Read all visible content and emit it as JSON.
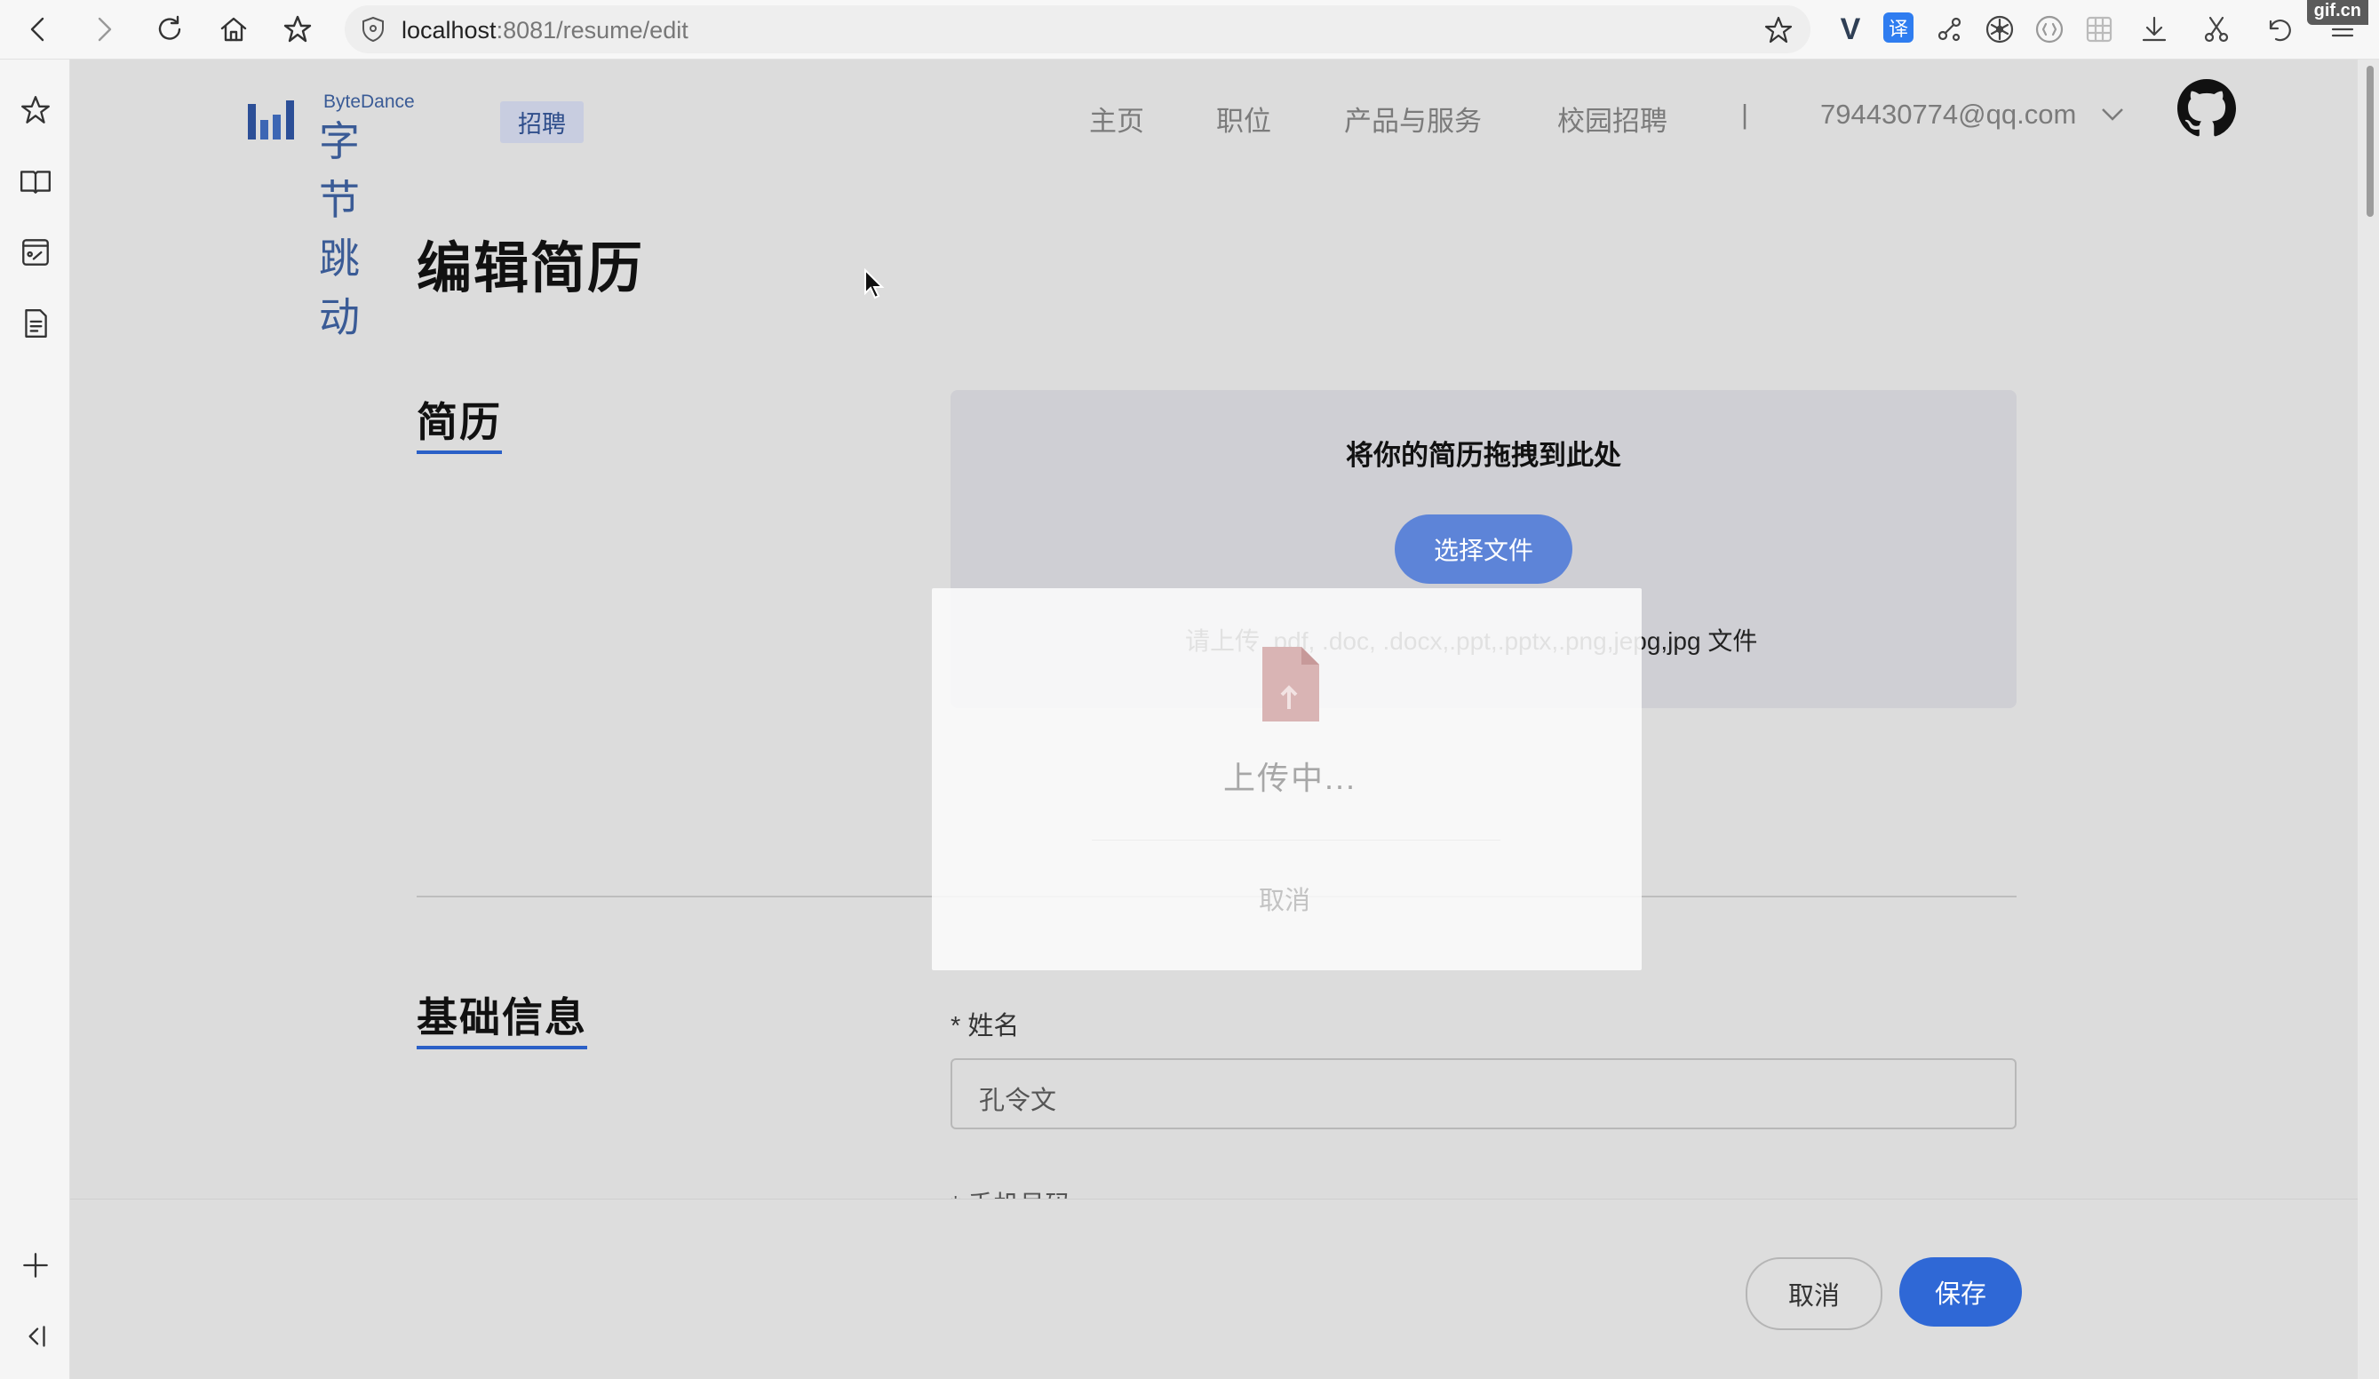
{
  "browser": {
    "url_host": "localhost",
    "url_rest": ":8081/resume/edit",
    "watermark": "gif.cn",
    "ext_translate": "译"
  },
  "header": {
    "logo_en": "ByteDance",
    "logo_cn": "字节跳动",
    "logo_badge": "招聘",
    "nav": [
      "主页",
      "职位",
      "产品与服务",
      "校园招聘"
    ],
    "separator": "|",
    "user_email": "794430774@qq.com"
  },
  "page": {
    "title": "编辑简历"
  },
  "resume_section": {
    "title": "简历",
    "dropzone_title": "将你的简历拖拽到此处",
    "choose_file": "选择文件",
    "hint": "请上传 .pdf, .doc, .docx,.ppt,.pptx,.png,jepg,jpg 文件"
  },
  "basic_section": {
    "title": "基础信息",
    "name_label": "* 姓名",
    "name_value": "孔令文",
    "phone_label": "* 手机号码"
  },
  "footer": {
    "cancel": "取消",
    "save": "保存"
  },
  "modal": {
    "status": "上传中...",
    "cancel": "取消"
  },
  "colors": {
    "brand": "#3a5b96",
    "primary": "#2f68d6",
    "underline": "#2b60c7"
  }
}
